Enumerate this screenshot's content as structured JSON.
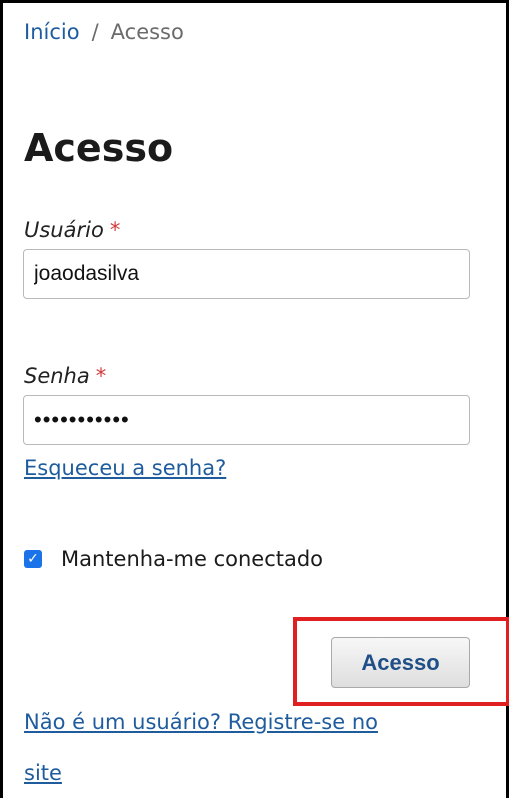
{
  "breadcrumb": {
    "home": "Início",
    "separator": "/",
    "current": "Acesso"
  },
  "page_title": "Acesso",
  "username": {
    "label": "Usuário",
    "required_mark": "*",
    "value": "joaodasilva"
  },
  "password": {
    "label": "Senha",
    "required_mark": "*",
    "masked_value": "•••••••••••"
  },
  "forgot_link": "Esqueceu a senha?",
  "remember_me": {
    "label": "Mantenha-me conectado",
    "checked": true
  },
  "submit_label": "Acesso",
  "register_link": {
    "line1": "Não é um usuário? Registre-se no",
    "line2": "site"
  },
  "colors": {
    "link": "#1f5c9e",
    "required": "#d13b3b",
    "checkbox": "#1a73e8",
    "highlight": "#e02020"
  }
}
